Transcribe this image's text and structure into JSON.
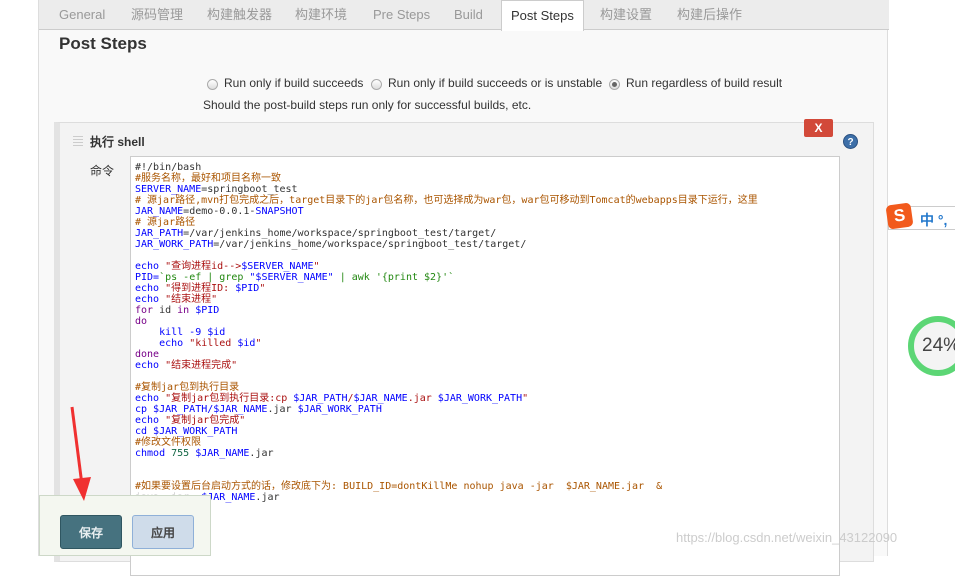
{
  "tabs": [
    "General",
    "源码管理",
    "构建触发器",
    "构建环境",
    "Pre Steps",
    "Build",
    "Post Steps",
    "构建设置",
    "构建后操作"
  ],
  "active_tab": "Post Steps",
  "section_title": "Post Steps",
  "radios": [
    {
      "label": "Run only if build succeeds",
      "checked": false
    },
    {
      "label": "Run only if build succeeds or is unstable",
      "checked": false
    },
    {
      "label": "Run regardless of build result",
      "checked": true
    }
  ],
  "hint": "Should the post-build steps run only for successful builds, etc.",
  "step": {
    "title": "执行 shell",
    "close_label": "X",
    "help_label": "?",
    "command_label": "命令"
  },
  "code": [
    [
      [
        "#!/bin/bash",
        "t"
      ]
    ],
    [
      [
        "#服务名称，最好和项目名称一致",
        "c"
      ]
    ],
    [
      [
        "SERVER_NAME",
        "v"
      ],
      [
        "=springboot_test",
        "t"
      ]
    ],
    [
      [
        "# 源jar路径,mvn打包完成之后，target目录下的jar包名称，也可选择成为war包，war包可移动到Tomcat的webapps目录下运行，这里",
        "c"
      ]
    ],
    [
      [
        "JAR_NAME",
        "v"
      ],
      [
        "=demo-0.0.1-",
        "t"
      ],
      [
        "SNAPSHOT",
        "v"
      ]
    ],
    [
      [
        "# 源jar路径",
        "c"
      ]
    ],
    [
      [
        "JAR_PATH",
        "v"
      ],
      [
        "=/var/jenkins_home/workspace/springboot_test/target/",
        "t"
      ]
    ],
    [
      [
        "JAR_WORK_PATH",
        "v"
      ],
      [
        "=/var/jenkins_home/workspace/springboot_test/target/",
        "t"
      ]
    ],
    [
      [
        "",
        "t"
      ]
    ],
    [
      [
        "echo ",
        "v"
      ],
      [
        "\"查询进程id-->",
        "s"
      ],
      [
        "$SERVER_NAME",
        "v"
      ],
      [
        "\"",
        "s"
      ]
    ],
    [
      [
        "PID=",
        "v"
      ],
      [
        "`ps -ef | grep ",
        "g"
      ],
      [
        "\"$SERVER_NAME\"",
        "v"
      ],
      [
        " | awk '{print $2}'`",
        "g"
      ]
    ],
    [
      [
        "echo ",
        "v"
      ],
      [
        "\"得到进程ID: ",
        "s"
      ],
      [
        "$PID",
        "v"
      ],
      [
        "\"",
        "s"
      ]
    ],
    [
      [
        "echo ",
        "v"
      ],
      [
        "\"结束进程\"",
        "s"
      ]
    ],
    [
      [
        "for ",
        "k"
      ],
      [
        "id ",
        "t"
      ],
      [
        "in ",
        "k"
      ],
      [
        "$PID",
        "v"
      ]
    ],
    [
      [
        "do",
        "k"
      ]
    ],
    [
      [
        "    kill -9 $id",
        "v"
      ]
    ],
    [
      [
        "    echo ",
        "v"
      ],
      [
        "\"killed ",
        "s"
      ],
      [
        "$id",
        "v"
      ],
      [
        "\"",
        "s"
      ]
    ],
    [
      [
        "done",
        "k"
      ]
    ],
    [
      [
        "echo ",
        "v"
      ],
      [
        "\"结束进程完成\"",
        "s"
      ]
    ],
    [
      [
        "",
        "t"
      ]
    ],
    [
      [
        "#复制jar包到执行目录",
        "c"
      ]
    ],
    [
      [
        "echo ",
        "v"
      ],
      [
        "\"复制jar包到执行目录:cp ",
        "s"
      ],
      [
        "$JAR_PATH",
        "v"
      ],
      [
        "/",
        "s"
      ],
      [
        "$JAR_NAME",
        "v"
      ],
      [
        ".jar ",
        "s"
      ],
      [
        "$JAR_WORK_PATH",
        "v"
      ],
      [
        "\"",
        "s"
      ]
    ],
    [
      [
        "cp $JAR_PATH/$JAR_NAME",
        "v"
      ],
      [
        ".jar ",
        "t"
      ],
      [
        "$JAR_WORK_PATH",
        "v"
      ]
    ],
    [
      [
        "echo ",
        "v"
      ],
      [
        "\"复制jar包完成\"",
        "s"
      ]
    ],
    [
      [
        "cd $JAR_WORK_PATH",
        "v"
      ]
    ],
    [
      [
        "#修改文件权限",
        "c"
      ]
    ],
    [
      [
        "chmod ",
        "v"
      ],
      [
        "755 ",
        "n"
      ],
      [
        "$JAR_NAME",
        "v"
      ],
      [
        ".jar",
        "t"
      ]
    ],
    [
      [
        "",
        "t"
      ]
    ],
    [
      [
        "",
        "t"
      ]
    ],
    [
      [
        "#如果要设置后台启动方式的话，修改底下为: BUILD_ID=dontKillMe nohup java -jar  $JAR_NAME.jar  &",
        "c"
      ]
    ],
    [
      [
        "java -jar  ",
        "f"
      ],
      [
        "$JAR_NAME",
        "v"
      ],
      [
        ".jar",
        "t"
      ]
    ]
  ],
  "buttons": {
    "save": "保存",
    "apply": "应用"
  },
  "ime": {
    "text": "中 °,"
  },
  "progress": {
    "value": 24,
    "label": "24%"
  },
  "watermark": "https://blog.csdn.net/weixin_43122090"
}
